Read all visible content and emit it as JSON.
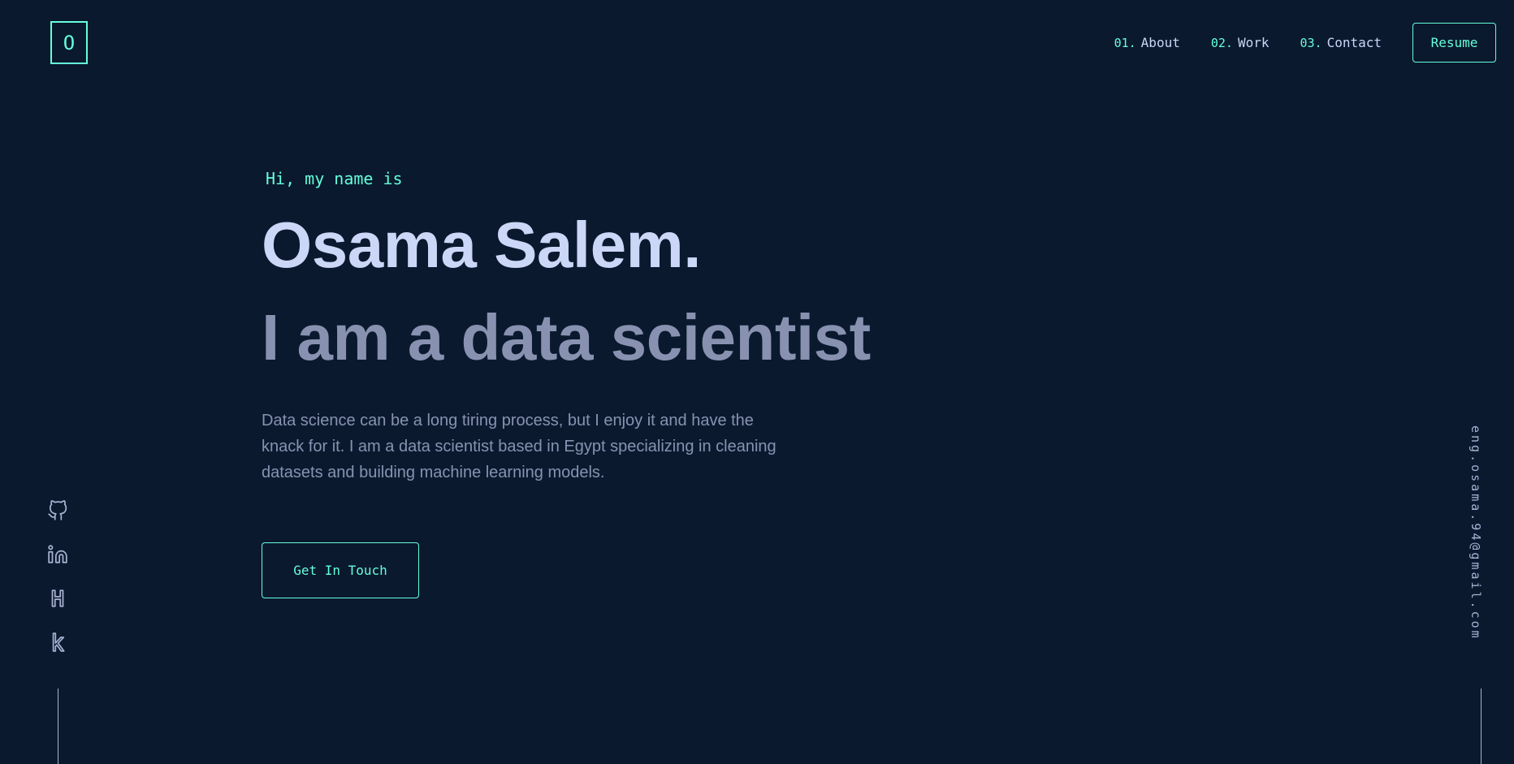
{
  "header": {
    "logo_letter": "O",
    "nav": [
      {
        "num": "01.",
        "label": "About"
      },
      {
        "num": "02.",
        "label": "Work"
      },
      {
        "num": "03.",
        "label": "Contact"
      }
    ],
    "resume_label": "Resume"
  },
  "hero": {
    "greeting": "Hi, my name is",
    "name": "Osama Salem.",
    "tagline": "I am a data scientist",
    "bio": "Data science can be a long tiring process, but I enjoy it and have the knack for it. I am a data scientist based in Egypt specializing in cleaning datasets and building machine learning models.",
    "cta_label": "Get In Touch"
  },
  "social": {
    "icons": [
      "github-icon",
      "linkedin-icon",
      "hashnode-icon",
      "kaggle-icon"
    ]
  },
  "email": "eng.osama.94@gmail.com",
  "colors": {
    "background": "#0b192f",
    "accent": "#64ffda",
    "heading": "#ccd6f6",
    "muted": "#8892b0"
  }
}
